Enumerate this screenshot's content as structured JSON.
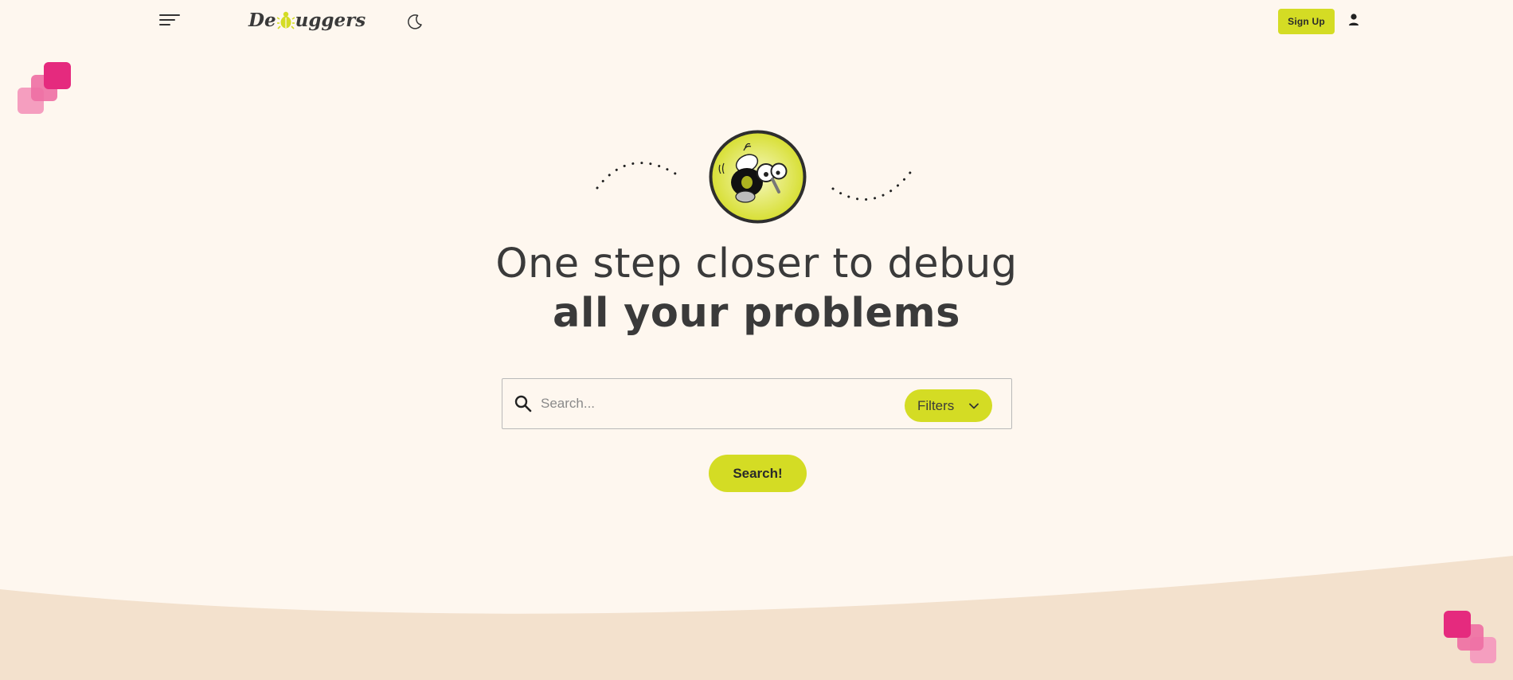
{
  "header": {
    "logo_prefix": "De",
    "logo_suffix": "uggers",
    "signup_label": "Sign Up"
  },
  "hero": {
    "headline_line1": "One step closer to debug",
    "headline_line2": "all your problems"
  },
  "search": {
    "placeholder": "Search...",
    "filters_label": "Filters",
    "submit_label": "Search!"
  },
  "icons": {
    "menu": "hamburger-menu-icon",
    "theme": "moon-icon",
    "user": "user-icon",
    "search": "magnifier-icon",
    "filters": "chevron-down-icon"
  },
  "colors": {
    "background": "#fef7ef",
    "accent": "#d4dc24",
    "footer_wave": "#f3e1cd",
    "pink_dark": "#e52a7e",
    "pink_mid": "#ee6ea3",
    "pink_light": "#f59ebf",
    "text": "#3a3a3a"
  }
}
